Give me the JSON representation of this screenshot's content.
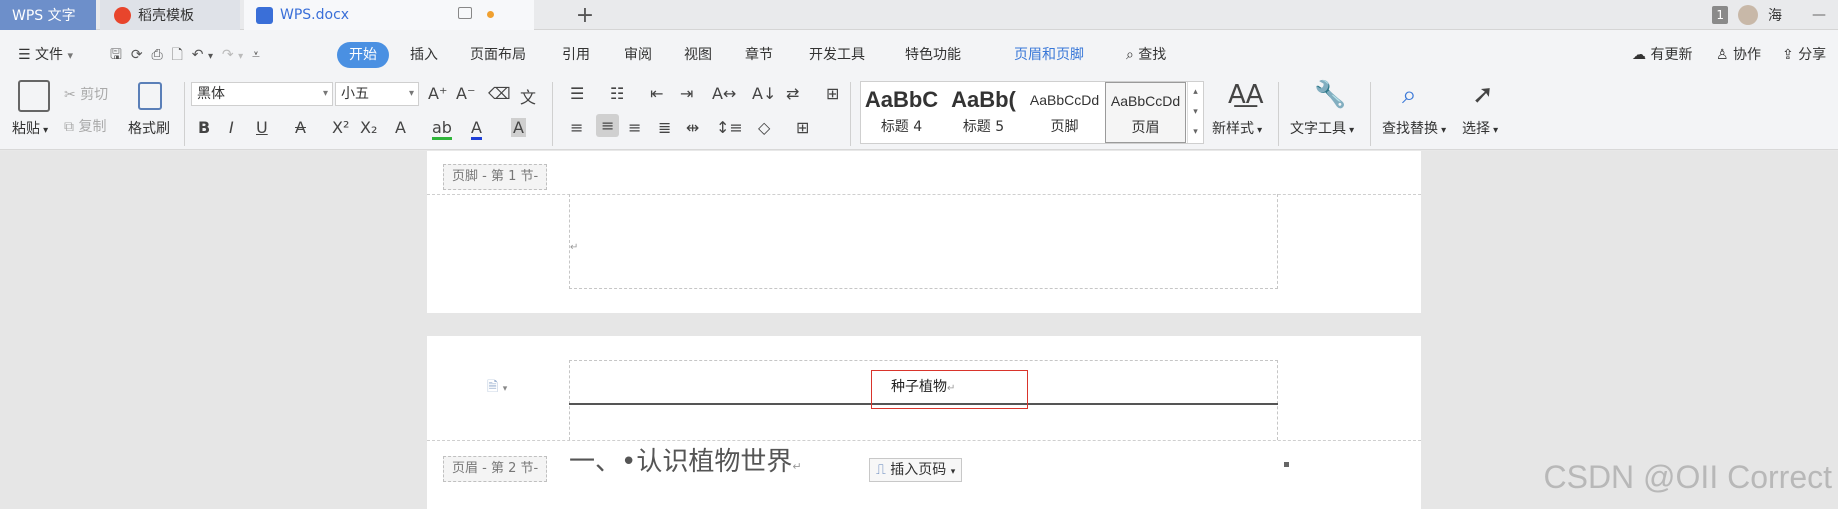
{
  "tabs": {
    "app": "WPS 文字",
    "doc1": "稻壳模板",
    "doc2": "WPS.docx",
    "add": "+"
  },
  "user": {
    "badge": "1",
    "name": "海"
  },
  "menu": {
    "file": "文件",
    "items": [
      "开始",
      "插入",
      "页面布局",
      "引用",
      "审阅",
      "视图",
      "章节",
      "开发工具",
      "特色功能"
    ],
    "header_footer": "页眉和页脚",
    "search": "查找",
    "update": "有更新",
    "collaborate": "协作",
    "share": "分享"
  },
  "ribbon": {
    "paste": "粘贴",
    "cut": "剪切",
    "copy": "复制",
    "format_painter": "格式刷",
    "font": "黑体",
    "size": "小五",
    "styles": [
      {
        "sample": "AaBbC",
        "name": "标题 4"
      },
      {
        "sample": "AaBb(",
        "name": "标题 5"
      },
      {
        "sample": "AaBbCcDd",
        "name": "页脚"
      },
      {
        "sample": "AaBbCcDd",
        "name": "页眉"
      }
    ],
    "new_style": "新样式",
    "text_tools": "文字工具",
    "find_replace": "查找替换",
    "select": "选择"
  },
  "document": {
    "footer_tag": "页脚 - 第 1 节-",
    "header_tag": "页眉 - 第 2 节-",
    "header_text": "种子植物",
    "insert_page_number": "插入页码",
    "heading": "一、•认识植物世界"
  },
  "watermark": "CSDN @OII Correct",
  "colors": {
    "accent": "#4a90e2",
    "app_tab": "#6d8fca",
    "header_link": "#3a6fd8",
    "selection_border": "#d9342b"
  }
}
